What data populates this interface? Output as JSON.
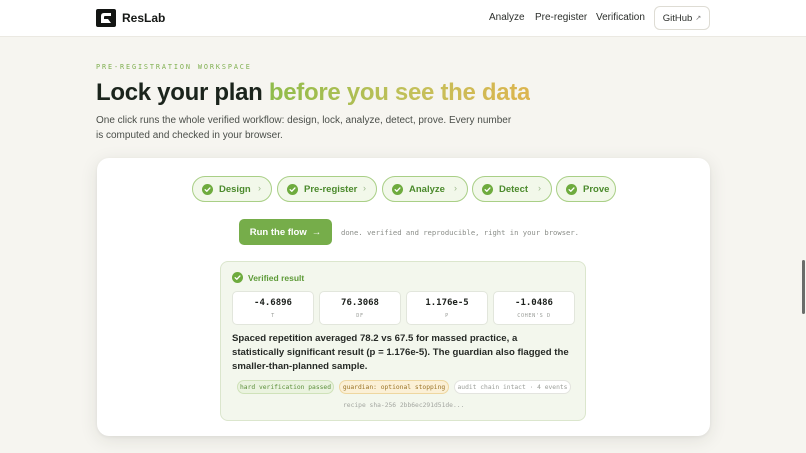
{
  "header": {
    "brand": "ResLab",
    "nav": [
      "Analyze",
      "Pre-register",
      "Verification"
    ],
    "github": "GitHub",
    "github_ext": "↗"
  },
  "hero": {
    "eyebrow": "PRE-REGISTRATION WORKSPACE",
    "title_dark": "Lock your plan ",
    "title_accent": "before you see the data",
    "subtitle": "One click runs the whole verified workflow: design, lock, analyze, detect, prove. Every number is computed and checked in your browser."
  },
  "workflow": {
    "steps": [
      "Design",
      "Pre-register",
      "Analyze",
      "Detect",
      "Prove"
    ],
    "run_label": "Run the flow",
    "run_arrow": "→",
    "status": "done. verified and reproducible, right in your browser."
  },
  "result": {
    "title": "Verified result",
    "stats": [
      {
        "value": "-4.6896",
        "label": "T"
      },
      {
        "value": "76.3068",
        "label": "DF"
      },
      {
        "value": "1.176e-5",
        "label": "P"
      },
      {
        "value": "-1.0486",
        "label": "COHEN'S D"
      }
    ],
    "summary": "Spaced repetition averaged 78.2 vs 67.5 for massed practice, a statistically significant result (p = 1.176e-5). The guardian also flagged the smaller-than-planned sample.",
    "tags": [
      "hard verification passed",
      "guardian: optional stopping",
      "audit chain intact · 4 events"
    ],
    "recipe": "recipe sha-256 2bb6ec291d51de..."
  },
  "colors": {
    "accent_green": "#76ad4a",
    "warning_amber": "#dcb54f"
  }
}
